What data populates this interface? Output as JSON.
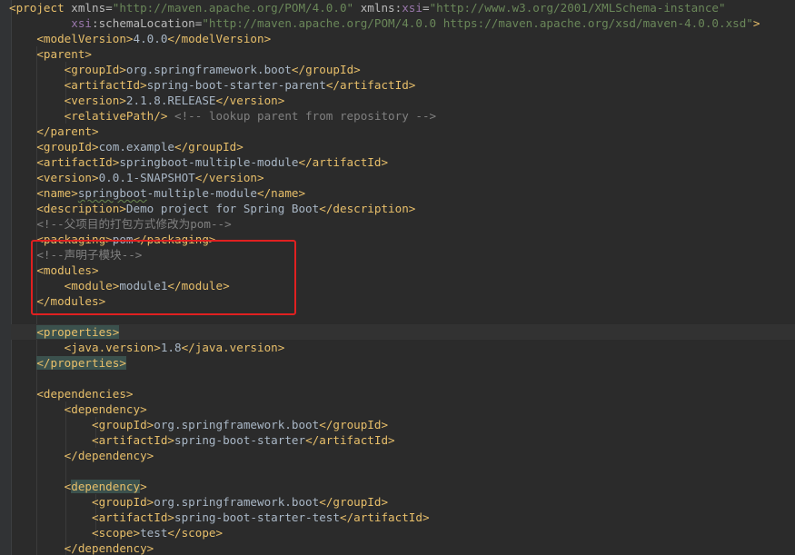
{
  "editor": {
    "language": "xml",
    "lines": [
      {
        "indent": 0,
        "tokens": [
          {
            "k": "tag",
            "t": "<project "
          },
          {
            "k": "attr",
            "t": "xmlns="
          },
          {
            "k": "attrv",
            "t": "\"http://maven.apache.org/POM/4.0.0\""
          },
          {
            "k": "txt",
            "t": " "
          },
          {
            "k": "attr",
            "t": "xmlns:"
          },
          {
            "k": "ns",
            "t": "xsi"
          },
          {
            "k": "attr",
            "t": "="
          },
          {
            "k": "attrv",
            "t": "\"http://www.w3.org/2001/XMLSchema-instance\""
          }
        ]
      },
      {
        "indent": 9,
        "tokens": [
          {
            "k": "ns",
            "t": "xsi"
          },
          {
            "k": "attr",
            "t": ":schemaLocation="
          },
          {
            "k": "attrv",
            "t": "\"http://maven.apache.org/POM/4.0.0 https://maven.apache.org/xsd/maven-4.0.0.xsd\""
          },
          {
            "k": "tag",
            "t": ">"
          }
        ]
      },
      {
        "indent": 4,
        "tokens": [
          {
            "k": "tag",
            "t": "<modelVersion>"
          },
          {
            "k": "txt",
            "t": "4.0.0"
          },
          {
            "k": "tag",
            "t": "</modelVersion>"
          }
        ]
      },
      {
        "indent": 4,
        "tokens": [
          {
            "k": "tag",
            "t": "<parent>"
          }
        ]
      },
      {
        "indent": 8,
        "tokens": [
          {
            "k": "tag",
            "t": "<groupId>"
          },
          {
            "k": "txt",
            "t": "org.springframework.boot"
          },
          {
            "k": "tag",
            "t": "</groupId>"
          }
        ]
      },
      {
        "indent": 8,
        "tokens": [
          {
            "k": "tag",
            "t": "<artifactId>"
          },
          {
            "k": "txt",
            "t": "spring-boot-starter-parent"
          },
          {
            "k": "tag",
            "t": "</artifactId>"
          }
        ]
      },
      {
        "indent": 8,
        "tokens": [
          {
            "k": "tag",
            "t": "<version>"
          },
          {
            "k": "txt",
            "t": "2.1.8.RELEASE"
          },
          {
            "k": "tag",
            "t": "</version>"
          }
        ]
      },
      {
        "indent": 8,
        "tokens": [
          {
            "k": "tag",
            "t": "<relativePath/>"
          },
          {
            "k": "txt",
            "t": " "
          },
          {
            "k": "cmt",
            "t": "<!-- lookup parent from repository -->"
          }
        ]
      },
      {
        "indent": 4,
        "tokens": [
          {
            "k": "tag",
            "t": "</parent>"
          }
        ]
      },
      {
        "indent": 4,
        "tokens": [
          {
            "k": "tag",
            "t": "<groupId>"
          },
          {
            "k": "txt",
            "t": "com.example"
          },
          {
            "k": "tag",
            "t": "</groupId>"
          }
        ]
      },
      {
        "indent": 4,
        "tokens": [
          {
            "k": "tag",
            "t": "<artifactId>"
          },
          {
            "k": "txt",
            "t": "springboot-multiple-module"
          },
          {
            "k": "tag",
            "t": "</artifactId>"
          }
        ]
      },
      {
        "indent": 4,
        "tokens": [
          {
            "k": "tag",
            "t": "<version>"
          },
          {
            "k": "txt",
            "t": "0.0.1-SNAPSHOT"
          },
          {
            "k": "tag",
            "t": "</version>"
          }
        ]
      },
      {
        "indent": 4,
        "tokens": [
          {
            "k": "tag",
            "t": "<name>"
          },
          {
            "k": "txt",
            "t": "springboot",
            "w": true
          },
          {
            "k": "txt",
            "t": "-multiple-module"
          },
          {
            "k": "tag",
            "t": "</name>"
          }
        ]
      },
      {
        "indent": 4,
        "tokens": [
          {
            "k": "tag",
            "t": "<description>"
          },
          {
            "k": "txt",
            "t": "Demo project for Spring Boot"
          },
          {
            "k": "tag",
            "t": "</description>"
          }
        ]
      },
      {
        "indent": 4,
        "tokens": [
          {
            "k": "cmt",
            "t": "<!--父项目的打包方式修改为pom-->"
          }
        ]
      },
      {
        "indent": 4,
        "tokens": [
          {
            "k": "tag",
            "t": "<packaging>"
          },
          {
            "k": "txt",
            "t": "pom"
          },
          {
            "k": "tag",
            "t": "</packaging>"
          }
        ]
      },
      {
        "indent": 4,
        "tokens": [
          {
            "k": "cmt",
            "t": "<!--声明子模块-->"
          }
        ]
      },
      {
        "indent": 4,
        "tokens": [
          {
            "k": "tag",
            "t": "<modules>"
          }
        ]
      },
      {
        "indent": 8,
        "tokens": [
          {
            "k": "tag",
            "t": "<module>"
          },
          {
            "k": "txt",
            "t": "module1"
          },
          {
            "k": "tag",
            "t": "</module>"
          }
        ]
      },
      {
        "indent": 4,
        "tokens": [
          {
            "k": "tag",
            "t": "</modules>"
          }
        ]
      },
      {
        "indent": 0,
        "tokens": []
      },
      {
        "indent": 4,
        "current": true,
        "tokens": [
          {
            "k": "tag",
            "t": "<properties>",
            "h": true
          }
        ]
      },
      {
        "indent": 8,
        "tokens": [
          {
            "k": "tag",
            "t": "<java.version>"
          },
          {
            "k": "txt",
            "t": "1.8"
          },
          {
            "k": "tag",
            "t": "</java.version>"
          }
        ]
      },
      {
        "indent": 4,
        "tokens": [
          {
            "k": "tag",
            "t": "</properties>",
            "h": true
          }
        ]
      },
      {
        "indent": 0,
        "tokens": []
      },
      {
        "indent": 4,
        "tokens": [
          {
            "k": "tag",
            "t": "<dependencies>"
          }
        ]
      },
      {
        "indent": 8,
        "tokens": [
          {
            "k": "tag",
            "t": "<dependency>"
          }
        ]
      },
      {
        "indent": 12,
        "tokens": [
          {
            "k": "tag",
            "t": "<groupId>"
          },
          {
            "k": "txt",
            "t": "org.springframework.boot"
          },
          {
            "k": "tag",
            "t": "</groupId>"
          }
        ]
      },
      {
        "indent": 12,
        "tokens": [
          {
            "k": "tag",
            "t": "<artifactId>"
          },
          {
            "k": "txt",
            "t": "spring-boot-starter"
          },
          {
            "k": "tag",
            "t": "</artifactId>"
          }
        ]
      },
      {
        "indent": 8,
        "tokens": [
          {
            "k": "tag",
            "t": "</dependency>"
          }
        ]
      },
      {
        "indent": 0,
        "tokens": []
      },
      {
        "indent": 8,
        "tokens": [
          {
            "k": "tag",
            "t": "<"
          },
          {
            "k": "tag",
            "t": "dependency",
            "h": true
          },
          {
            "k": "tag",
            "t": ">"
          }
        ]
      },
      {
        "indent": 12,
        "tokens": [
          {
            "k": "tag",
            "t": "<groupId>"
          },
          {
            "k": "txt",
            "t": "org.springframework.boot"
          },
          {
            "k": "tag",
            "t": "</groupId>"
          }
        ]
      },
      {
        "indent": 12,
        "tokens": [
          {
            "k": "tag",
            "t": "<artifactId>"
          },
          {
            "k": "txt",
            "t": "spring-boot-starter-test"
          },
          {
            "k": "tag",
            "t": "</artifactId>"
          }
        ]
      },
      {
        "indent": 12,
        "tokens": [
          {
            "k": "tag",
            "t": "<scope>"
          },
          {
            "k": "txt",
            "t": "test"
          },
          {
            "k": "tag",
            "t": "</scope>"
          }
        ]
      },
      {
        "indent": 8,
        "tokens": [
          {
            "k": "tag",
            "t": "</dependency>"
          }
        ]
      }
    ]
  },
  "colors": {
    "background": "#2b2b2b",
    "tag": "#e8bf6a",
    "attribute": "#bababa",
    "attribute_value": "#6a8759",
    "namespace": "#9876aa",
    "text": "#a9b7c6",
    "comment": "#808080",
    "annotation_box": "#e02020"
  }
}
